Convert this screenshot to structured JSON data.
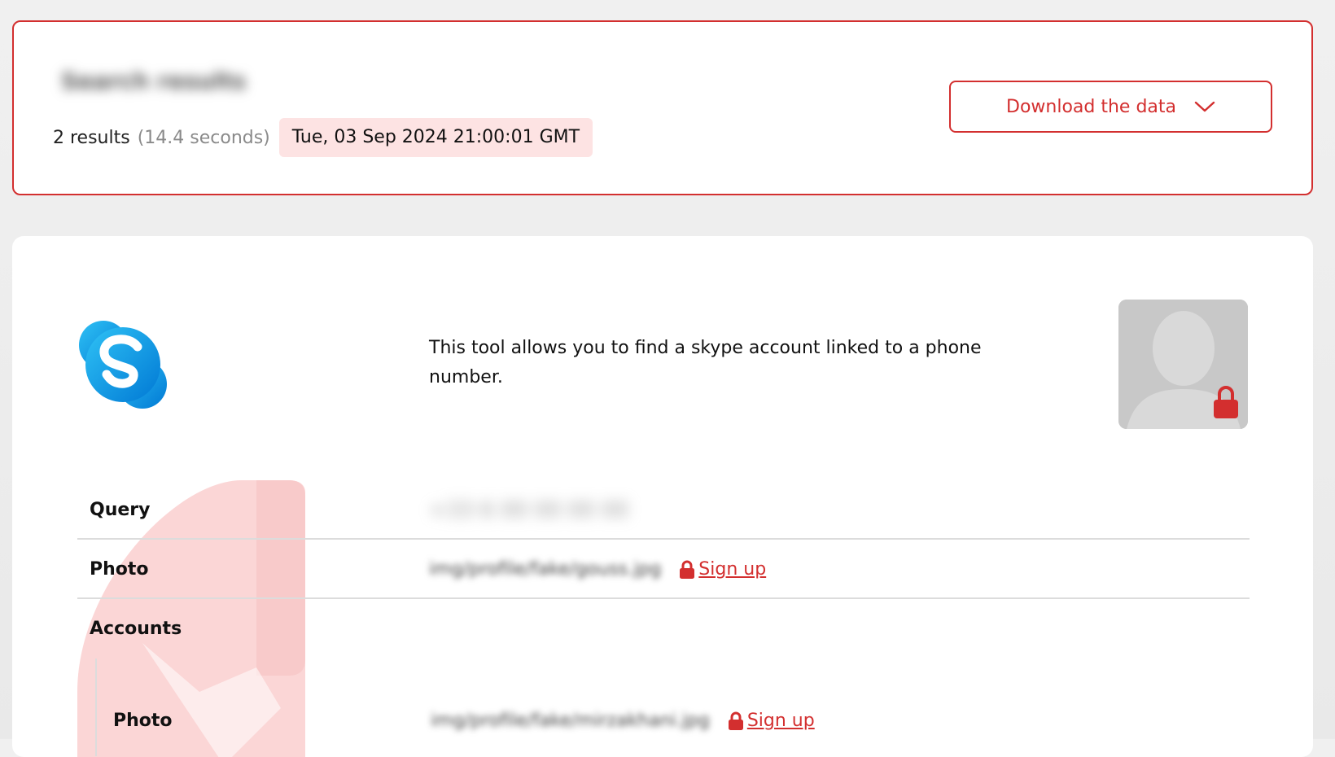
{
  "summary": {
    "blurred_title": "Search results",
    "results_count": "2 results",
    "search_time": "(14.4 seconds)",
    "timestamp": "Tue, 03 Sep 2024 21:00:01 GMT",
    "download_label": "Download the data"
  },
  "result": {
    "description": "This tool allows you to find a skype account linked to a phone number.",
    "rows": {
      "query_label": "Query",
      "query_value": "+33 6 00 00 00 00",
      "photo_label": "Photo",
      "photo_value": "img/profile/fake/gouss.jpg",
      "photo_signup": "Sign up",
      "accounts_label": "Accounts"
    },
    "accounts": {
      "photo_label": "Photo",
      "photo_value": "img/profile/fake/mirzakhani.jpg",
      "photo_signup": "Sign up"
    }
  },
  "colors": {
    "accent": "#d32f2f",
    "timestamp_bg": "#fde3e3",
    "skype_blue": "#00aff0"
  },
  "icons": {
    "download_chevron": "chevron-down-icon",
    "lock": "lock-icon",
    "skype": "skype-logo",
    "avatar": "avatar-placeholder-icon",
    "watermark": "phone-watermark"
  }
}
